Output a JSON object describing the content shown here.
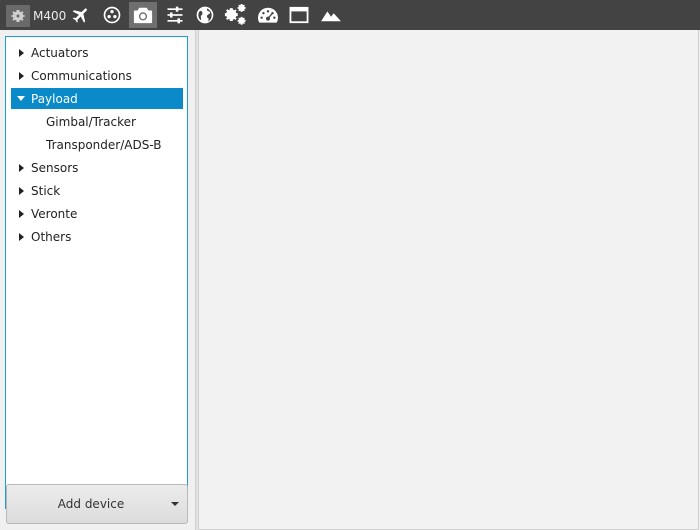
{
  "toolbar": {
    "device_name": "M400",
    "icons": [
      {
        "name": "airplane-icon"
      },
      {
        "name": "joystick-icon"
      },
      {
        "name": "camera-icon",
        "active": true
      },
      {
        "name": "sliders-icon"
      },
      {
        "name": "globe-icon"
      },
      {
        "name": "gears-icon"
      },
      {
        "name": "dashboard-icon"
      },
      {
        "name": "window-icon"
      },
      {
        "name": "mountain-icon"
      }
    ]
  },
  "tree": {
    "items": [
      {
        "label": "Actuators",
        "expanded": false
      },
      {
        "label": "Communications",
        "expanded": false
      },
      {
        "label": "Payload",
        "expanded": true,
        "selected": true
      },
      {
        "label": "Gimbal/Tracker",
        "child": true
      },
      {
        "label": "Transponder/ADS-B",
        "child": true
      },
      {
        "label": "Sensors",
        "expanded": false
      },
      {
        "label": "Stick",
        "expanded": false
      },
      {
        "label": "Veronte",
        "expanded": false
      },
      {
        "label": "Others",
        "expanded": false
      }
    ]
  },
  "add_device": {
    "label": "Add device"
  },
  "colors": {
    "toolbar_bg": "#434343",
    "selection": "#0a8ac8",
    "tree_border": "#1e9bd3"
  }
}
